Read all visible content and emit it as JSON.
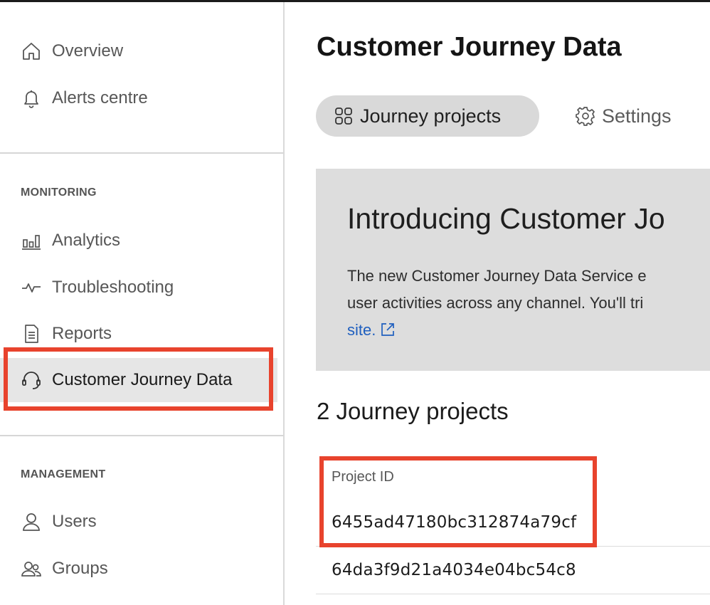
{
  "sidebar": {
    "top_items": [
      {
        "label": "Overview",
        "icon": "home-icon"
      },
      {
        "label": "Alerts centre",
        "icon": "bell-icon"
      }
    ],
    "monitoring": {
      "title": "MONITORING",
      "items": [
        {
          "label": "Analytics",
          "icon": "bar-chart-icon"
        },
        {
          "label": "Troubleshooting",
          "icon": "pulse-icon"
        },
        {
          "label": "Reports",
          "icon": "document-icon"
        },
        {
          "label": "Customer Journey Data",
          "icon": "headset-icon",
          "active": true
        }
      ]
    },
    "management": {
      "title": "MANAGEMENT",
      "items": [
        {
          "label": "Users",
          "icon": "user-icon"
        },
        {
          "label": "Groups",
          "icon": "group-icon"
        }
      ]
    }
  },
  "main": {
    "title": "Customer Journey Data",
    "tabs": [
      {
        "label": "Journey projects",
        "icon": "grid-icon",
        "active": true
      },
      {
        "label": "Settings",
        "icon": "gear-icon",
        "active": false
      }
    ],
    "banner": {
      "title": "Introducing Customer Jo",
      "line1": "The new Customer Journey Data Service e",
      "line2": "user activities across any channel. You'll tri",
      "link": "site."
    },
    "projects_heading": "2 Journey projects",
    "table": {
      "header": "Project ID",
      "rows": [
        "6455ad47180bc312874a79cf",
        "64da3f9d21a4034e04bc54c8"
      ]
    }
  },
  "colors": {
    "highlight": "#e8432d",
    "active_bg": "#e6e6e6",
    "banner_bg": "#dddddd",
    "link": "#1f5fbf"
  }
}
